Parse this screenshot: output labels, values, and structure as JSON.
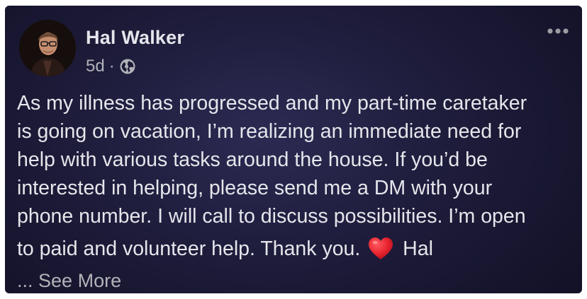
{
  "post": {
    "author": "Hal Walker",
    "time": "5d",
    "separator": "·",
    "audience_icon": "globe-icon",
    "more_icon": "more-horizontal-icon",
    "body_lines": [
      "As my illness has progressed and my part-time caretaker",
      "is going on vacation, I’m realizing an immediate need for",
      "help with various tasks around the house. If you’d be",
      "interested in helping, please send me a DM with your",
      "phone number. I will call to discuss possibilities. I’m open"
    ],
    "last_line_before": "to paid and volunteer help. Thank you.",
    "emoji": "red-heart-icon",
    "last_line_after": "Hal",
    "ellipsis": "...",
    "see_more": "See More"
  },
  "colors": {
    "background": "#1c1a37",
    "text": "#e4e6eb",
    "secondary_text": "#b0b3b8",
    "heart": "#e8232f"
  }
}
